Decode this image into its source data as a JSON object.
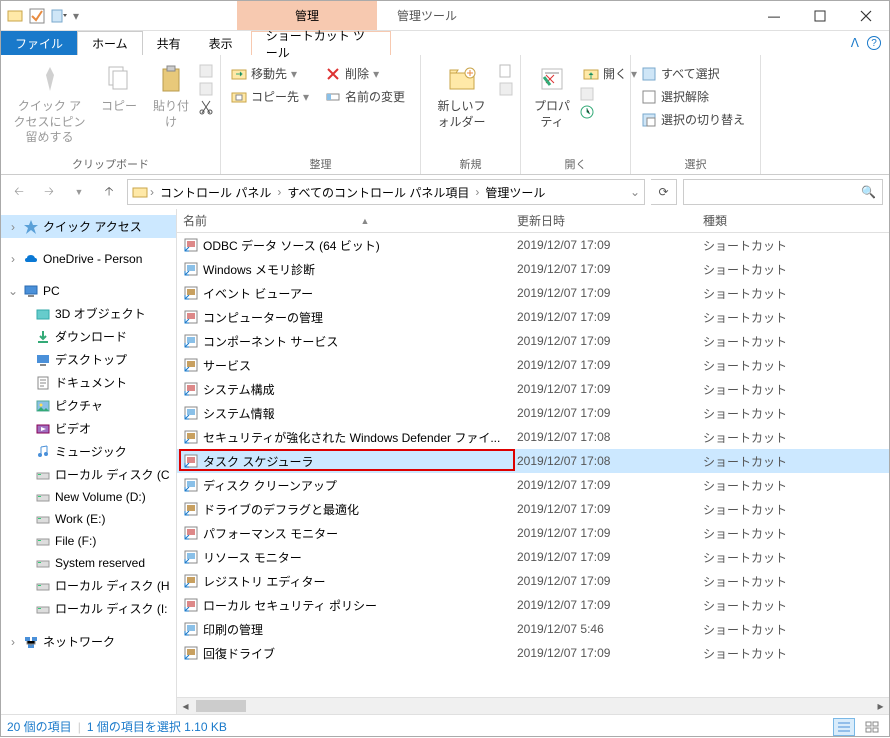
{
  "window": {
    "contextual_title": "管理",
    "title": "管理ツール"
  },
  "tabs": {
    "file": "ファイル",
    "home": "ホーム",
    "share": "共有",
    "view": "表示",
    "contextual": "ショートカット ツール"
  },
  "ribbon": {
    "clipboard": {
      "quick_access": "クイック アクセスにピン留めする",
      "copy": "コピー",
      "paste": "貼り付け",
      "label": "クリップボード"
    },
    "organize": {
      "move_to": "移動先",
      "copy_to": "コピー先",
      "delete": "削除",
      "rename": "名前の変更",
      "label": "整理"
    },
    "new": {
      "new_folder": "新しいフォルダー",
      "label": "新規"
    },
    "open": {
      "properties": "プロパティ",
      "open": "開く",
      "label": "開く"
    },
    "select": {
      "select_all": "すべて選択",
      "deselect": "選択解除",
      "invert": "選択の切り替え",
      "label": "選択"
    }
  },
  "breadcrumb": {
    "items": [
      "コントロール パネル",
      "すべてのコントロール パネル項目",
      "管理ツール"
    ]
  },
  "nav": {
    "quick_access": "クイック アクセス",
    "onedrive": "OneDrive - Person",
    "pc": "PC",
    "pc_items": [
      "3D オブジェクト",
      "ダウンロード",
      "デスクトップ",
      "ドキュメント",
      "ピクチャ",
      "ビデオ",
      "ミュージック",
      "ローカル ディスク (C",
      "New Volume (D:)",
      "Work (E:)",
      "File (F:)",
      "System reserved",
      "ローカル ディスク (H",
      "ローカル ディスク (I:"
    ],
    "network": "ネットワーク"
  },
  "columns": {
    "name": "名前",
    "date": "更新日時",
    "type": "種類"
  },
  "files": [
    {
      "name": "ODBC データ ソース (64 ビット)",
      "date": "2019/12/07 17:09",
      "type": "ショートカット"
    },
    {
      "name": "Windows メモリ診断",
      "date": "2019/12/07 17:09",
      "type": "ショートカット"
    },
    {
      "name": "イベント ビューアー",
      "date": "2019/12/07 17:09",
      "type": "ショートカット"
    },
    {
      "name": "コンピューターの管理",
      "date": "2019/12/07 17:09",
      "type": "ショートカット"
    },
    {
      "name": "コンポーネント サービス",
      "date": "2019/12/07 17:09",
      "type": "ショートカット"
    },
    {
      "name": "サービス",
      "date": "2019/12/07 17:09",
      "type": "ショートカット"
    },
    {
      "name": "システム構成",
      "date": "2019/12/07 17:09",
      "type": "ショートカット"
    },
    {
      "name": "システム情報",
      "date": "2019/12/07 17:09",
      "type": "ショートカット"
    },
    {
      "name": "セキュリティが強化された Windows Defender ファイ...",
      "date": "2019/12/07 17:08",
      "type": "ショートカット"
    },
    {
      "name": "タスク スケジューラ",
      "date": "2019/12/07 17:08",
      "type": "ショートカット",
      "selected": true,
      "highlight": true
    },
    {
      "name": "ディスク クリーンアップ",
      "date": "2019/12/07 17:09",
      "type": "ショートカット"
    },
    {
      "name": "ドライブのデフラグと最適化",
      "date": "2019/12/07 17:09",
      "type": "ショートカット"
    },
    {
      "name": "パフォーマンス モニター",
      "date": "2019/12/07 17:09",
      "type": "ショートカット"
    },
    {
      "name": "リソース モニター",
      "date": "2019/12/07 17:09",
      "type": "ショートカット"
    },
    {
      "name": "レジストリ エディター",
      "date": "2019/12/07 17:09",
      "type": "ショートカット"
    },
    {
      "name": "ローカル セキュリティ ポリシー",
      "date": "2019/12/07 17:09",
      "type": "ショートカット"
    },
    {
      "name": "印刷の管理",
      "date": "2019/12/07 5:46",
      "type": "ショートカット"
    },
    {
      "name": "回復ドライブ",
      "date": "2019/12/07 17:09",
      "type": "ショートカット"
    }
  ],
  "status": {
    "count": "20 個の項目",
    "selection": "1 個の項目を選択 1.10 KB"
  }
}
